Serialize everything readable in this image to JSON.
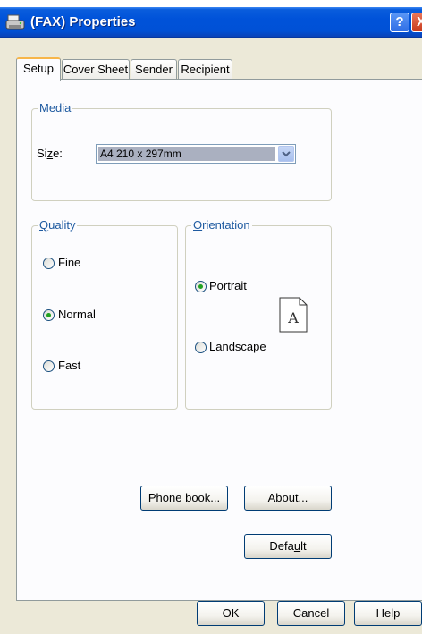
{
  "window": {
    "title": "(FAX) Properties",
    "help_glyph": "?",
    "close_glyph": "X"
  },
  "tabs": [
    {
      "label": "Setup",
      "active": true
    },
    {
      "label": "Cover Sheet",
      "active": false
    },
    {
      "label": "Sender",
      "active": false
    },
    {
      "label": "Recipient",
      "active": false
    }
  ],
  "media": {
    "legend": "Media",
    "size_label_pre": "Si",
    "size_label_ul": "z",
    "size_label_post": "e:",
    "size_value": "A4 210 x 297mm"
  },
  "quality": {
    "legend_ul": "Q",
    "legend_post": "uality",
    "options": [
      {
        "label": "Fine",
        "checked": false
      },
      {
        "label": "Normal",
        "checked": true
      },
      {
        "label": "Fast",
        "checked": false
      }
    ]
  },
  "orientation": {
    "legend_ul": "O",
    "legend_post": "rientation",
    "options": [
      {
        "label": "Portrait",
        "checked": true
      },
      {
        "label": "Landscape",
        "checked": false
      }
    ],
    "page_glyph": "A"
  },
  "buttons": {
    "phone_book_pre": "P",
    "phone_book_ul": "h",
    "phone_book_post": "one book...",
    "about_pre": "A",
    "about_ul": "b",
    "about_post": "out...",
    "default_pre": "Defa",
    "default_ul": "u",
    "default_post": "lt",
    "ok": "OK",
    "cancel": "Cancel",
    "help": "Help"
  },
  "colors": {
    "titlebar": "#0052d9",
    "dialog_bg": "#ece9d8",
    "tab_accent": "#f7b64a",
    "group_legend": "#1e5aa0",
    "radio_dot": "#21a121"
  },
  "icons": {
    "title": "fax-printer-icon",
    "dropdown": "chevron-down-icon",
    "page": "portrait-page-icon"
  }
}
